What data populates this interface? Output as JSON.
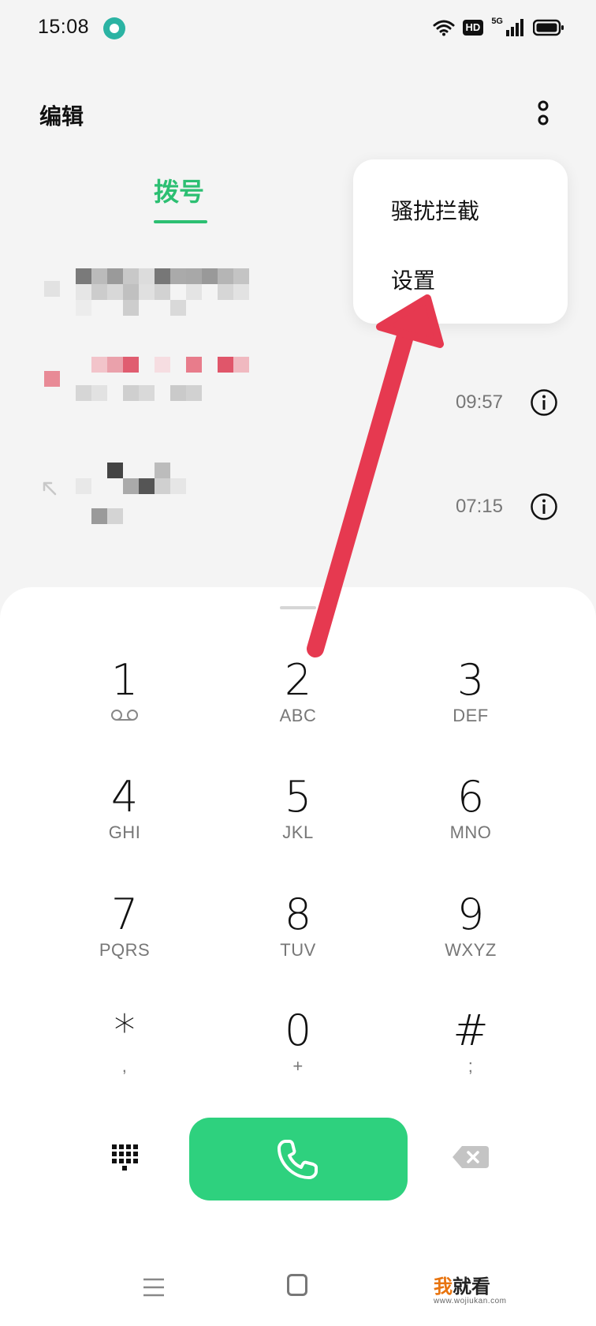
{
  "status_bar": {
    "time": "15:08",
    "hd_label": "HD",
    "network_label": "5G",
    "icons": [
      "app-notification-icon",
      "wifi-icon",
      "hd-voice-icon",
      "signal-icon",
      "battery-icon"
    ]
  },
  "header": {
    "edit_label": "编辑",
    "more_icon": "more-vertical-icon"
  },
  "tabs": [
    {
      "label": "拨号",
      "active": true
    }
  ],
  "call_log": [
    {
      "time": "09:57",
      "icon": "info-icon"
    },
    {
      "time": "07:15",
      "icon": "info-icon",
      "direction_icon": "outgoing-arrow-icon"
    }
  ],
  "popup_menu": {
    "items": [
      {
        "label": "骚扰拦截"
      },
      {
        "label": "设置"
      }
    ]
  },
  "dial_pad": {
    "keys": [
      {
        "digit": "1",
        "letters": ""
      },
      {
        "digit": "2",
        "letters": "ABC"
      },
      {
        "digit": "3",
        "letters": "DEF"
      },
      {
        "digit": "4",
        "letters": "GHI"
      },
      {
        "digit": "5",
        "letters": "JKL"
      },
      {
        "digit": "6",
        "letters": "MNO"
      },
      {
        "digit": "7",
        "letters": "PQRS"
      },
      {
        "digit": "8",
        "letters": "TUV"
      },
      {
        "digit": "9",
        "letters": "WXYZ"
      },
      {
        "digit": "*",
        "letters": ","
      },
      {
        "digit": "0",
        "letters": "+"
      },
      {
        "digit": "#",
        "letters": ";"
      }
    ],
    "voicemail_icon": "voicemail-icon",
    "call_icon": "phone-icon",
    "keypad_icon": "keypad-grid-icon",
    "backspace_icon": "backspace-icon"
  },
  "colors": {
    "accent": "#2cbf72",
    "call_button": "#2ed17e",
    "annotation_arrow": "#e63950"
  },
  "nav_bar": {
    "icons": [
      "menu-icon",
      "home-icon"
    ]
  },
  "watermark": {
    "first": "我",
    "rest": "就看",
    "url": "www.wojiukan.com"
  }
}
